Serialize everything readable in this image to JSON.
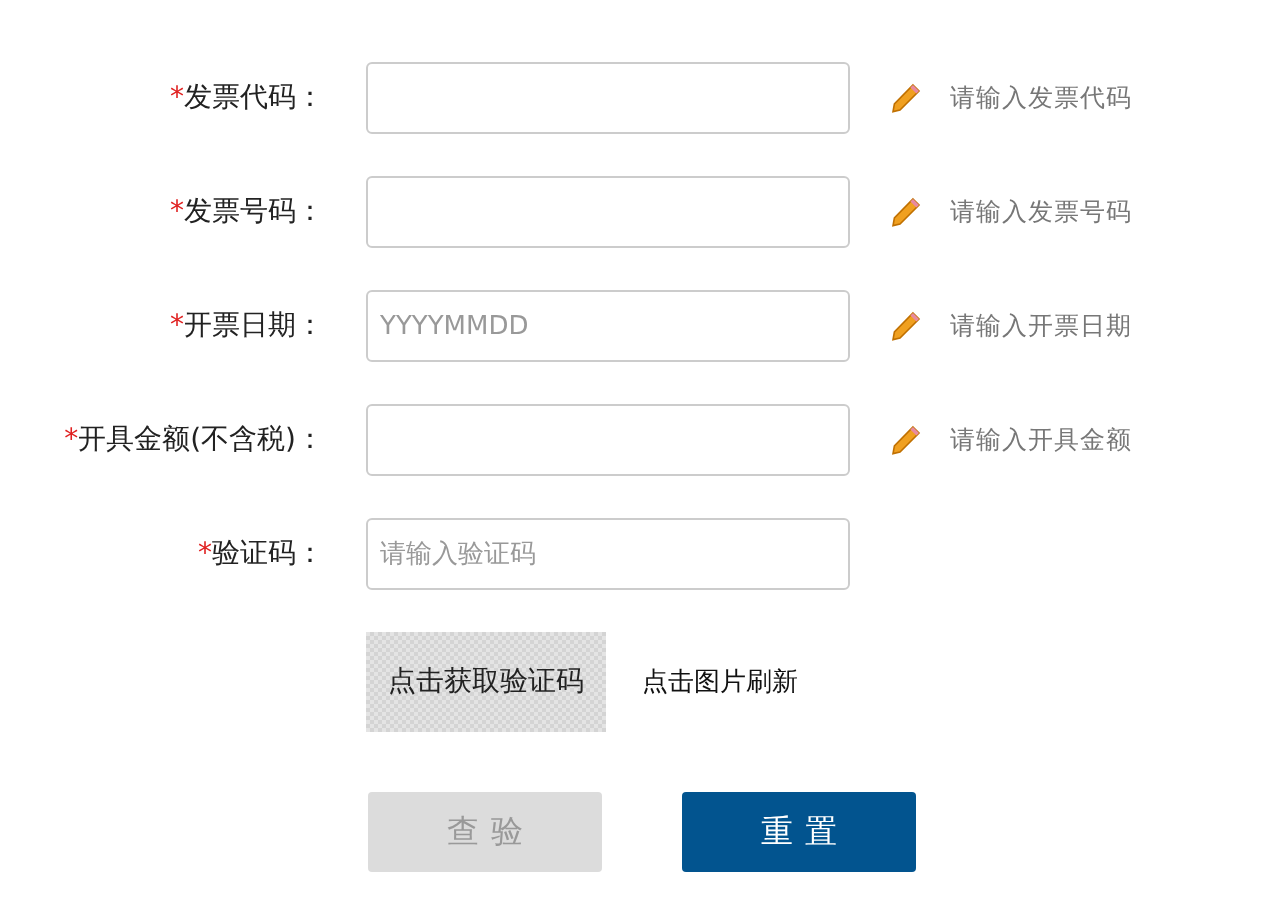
{
  "fields": [
    {
      "required_mark": "*",
      "label": "发票代码：",
      "hint": "请输入发票代码"
    },
    {
      "required_mark": "*",
      "label": "发票号码：",
      "hint": "请输入发票号码"
    },
    {
      "required_mark": "*",
      "label": "开票日期：",
      "placeholder": "YYYYMMDD",
      "hint": "请输入开票日期"
    },
    {
      "required_mark": "*",
      "label": "开具金额(不含税)：",
      "hint": "请输入开具金额"
    },
    {
      "required_mark": "*",
      "label": "验证码：",
      "placeholder": "请输入验证码"
    }
  ],
  "captcha": {
    "text": "点击获取验证码",
    "refresh_hint": "点击图片刷新"
  },
  "buttons": [
    {
      "label": "查验",
      "disabled": true
    },
    {
      "label": "重置",
      "disabled": false
    }
  ]
}
